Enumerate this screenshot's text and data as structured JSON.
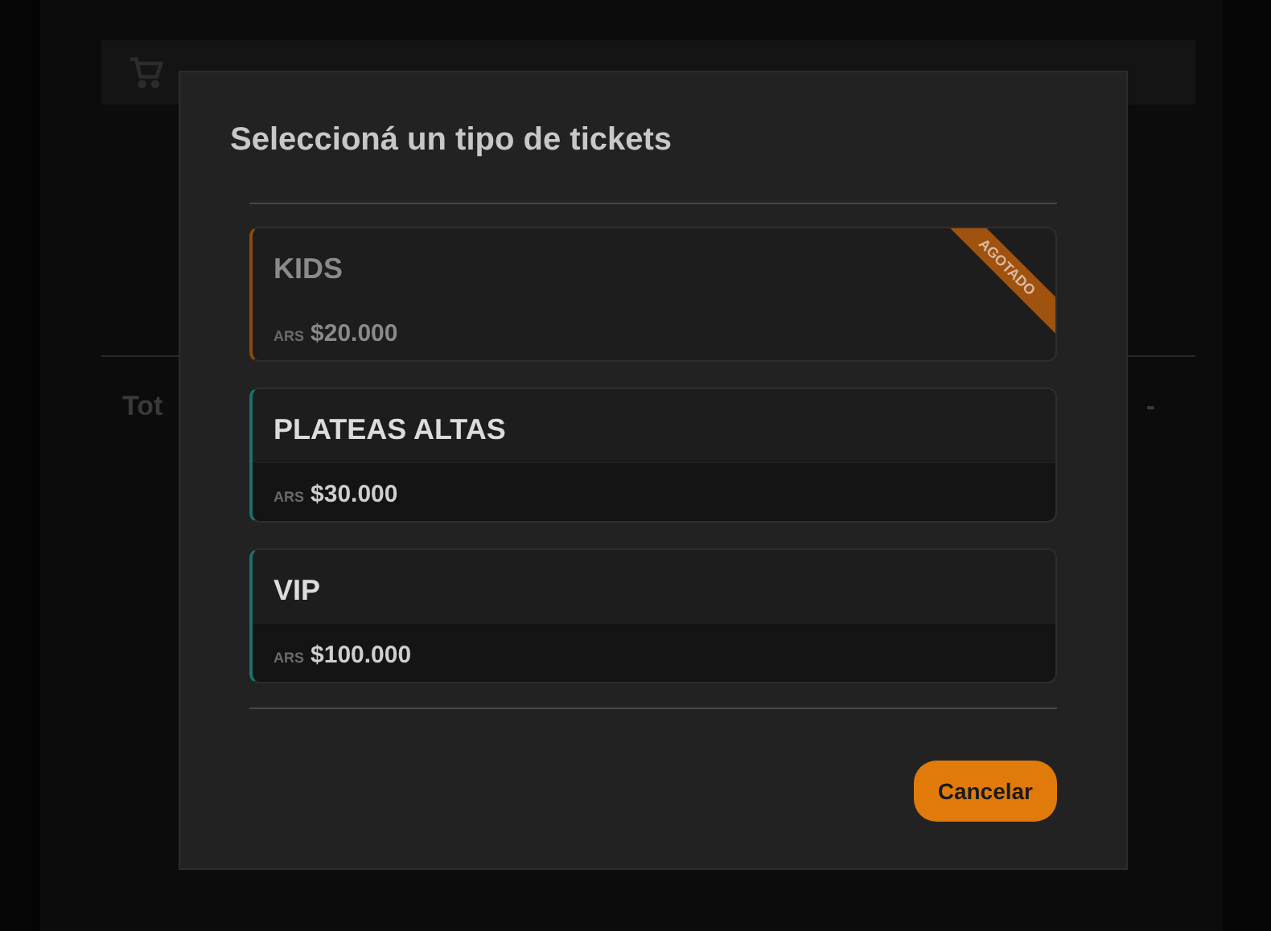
{
  "background": {
    "total_label": "Tot",
    "total_value": "-"
  },
  "dialog": {
    "title": "Seleccioná un tipo de tickets",
    "tickets": [
      {
        "name": "KIDS",
        "currency": "ARS",
        "price": "$20.000",
        "sold_out": true,
        "badge": "AGOTADO"
      },
      {
        "name": "PLATEAS ALTAS",
        "currency": "ARS",
        "price": "$30.000",
        "sold_out": false
      },
      {
        "name": "VIP",
        "currency": "ARS",
        "price": "$100.000",
        "sold_out": false
      }
    ],
    "cancel_button": "Cancelar"
  }
}
